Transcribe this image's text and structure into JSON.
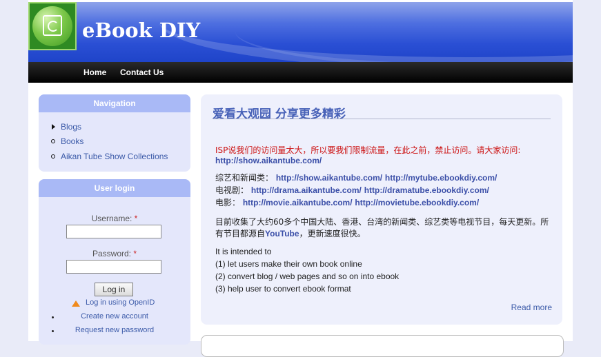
{
  "site": {
    "name": "eBook DIY"
  },
  "nav_primary": [
    {
      "label": "Home"
    },
    {
      "label": "Contact Us"
    }
  ],
  "navigation_block": {
    "title": "Navigation",
    "items": [
      {
        "label": "Blogs"
      },
      {
        "label": "Books"
      },
      {
        "label": "Aikan Tube Show Collections"
      }
    ]
  },
  "login_block": {
    "title": "User login",
    "username_label": "Username:",
    "password_label": "Password:",
    "required_mark": "*",
    "login_button": "Log in",
    "openid_link": "Log in using OpenID",
    "create_account": "Create new account",
    "request_password": "Request new password"
  },
  "post": {
    "title": "爱看大观园 分享更多精彩",
    "notice": "ISP说我们的访问量太大，所以要我们限制流量，在此之前，禁止访问。请大家访问:",
    "notice_link": "http://show.aikantube.com/",
    "lines": [
      {
        "label": "综艺和新闻类：",
        "link1": "http://show.aikantube.com/",
        "link2": "http://mytube.ebookdiy.com/"
      },
      {
        "label": "电视剧：",
        "link1": "http://drama.aikantube.com/",
        "link2": "http://dramatube.ebookdiy.com/"
      },
      {
        "label": "电影：",
        "link1": "http://movie.aikantube.com/",
        "link2": "http://movietube.ebookdiy.com/"
      }
    ],
    "para_line1": "目前收集了大约60多个中国大陆、香港、台湾的新闻类、综艺类等电视节目，每天更新。所",
    "para_line2_a": "有节目都源自",
    "para_line2_link": "YouTube",
    "para_line2_b": "，更新速度很快。",
    "intent": [
      "It is intended to",
      "(1) let users make their own book online",
      "(2) convert blog / web pages and so on into ebook",
      "(3) help user to convert ebook format"
    ],
    "read_more": "Read more"
  }
}
